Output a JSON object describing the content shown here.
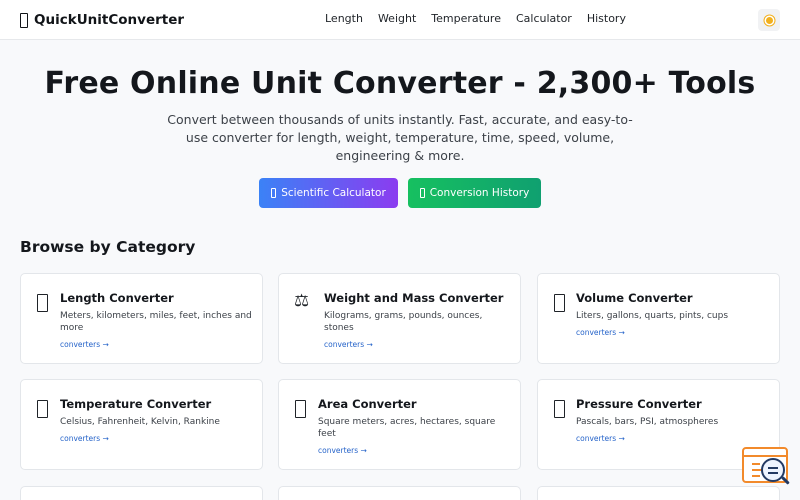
{
  "header": {
    "brand": "QuickUnitConverter",
    "nav": [
      "Length",
      "Weight",
      "Temperature",
      "Calculator",
      "History"
    ]
  },
  "hero": {
    "title": "Free Online Unit Converter - 2,300+ Tools",
    "subtitle": "Convert between thousands of units instantly. Fast, accurate, and easy-to-use converter for length, weight, temperature, time, speed, volume, engineering & more.",
    "calc_button": "Scientific Calculator",
    "history_button": "Conversion History"
  },
  "section_title": "Browse by Category",
  "cards": [
    {
      "title": "Length Converter",
      "desc": "Meters, kilometers, miles, feet, inches and more",
      "link": "converters →",
      "icon": "ruler-icon"
    },
    {
      "title": "Weight and Mass Converter",
      "desc": "Kilograms, grams, pounds, ounces, stones",
      "link": "converters →",
      "icon": "scale-icon",
      "glyph": "⚖"
    },
    {
      "title": "Volume Converter",
      "desc": "Liters, gallons, quarts, pints, cups",
      "link": "converters →",
      "icon": "beaker-icon"
    },
    {
      "title": "Temperature Converter",
      "desc": "Celsius, Fahrenheit, Kelvin, Rankine",
      "link": "converters →",
      "icon": "thermometer-icon"
    },
    {
      "title": "Area Converter",
      "desc": "Square meters, acres, hectares, square feet",
      "link": "converters →",
      "icon": "area-icon"
    },
    {
      "title": "Pressure Converter",
      "desc": "Pascals, bars, PSI, atmospheres",
      "link": "converters →",
      "icon": "gauge-icon"
    }
  ],
  "colors": {
    "calc_gradient": [
      "#3b82f6",
      "#8b3cf0"
    ],
    "history_gradient": [
      "#16c060",
      "#10a070"
    ],
    "link": "#2563c9"
  }
}
